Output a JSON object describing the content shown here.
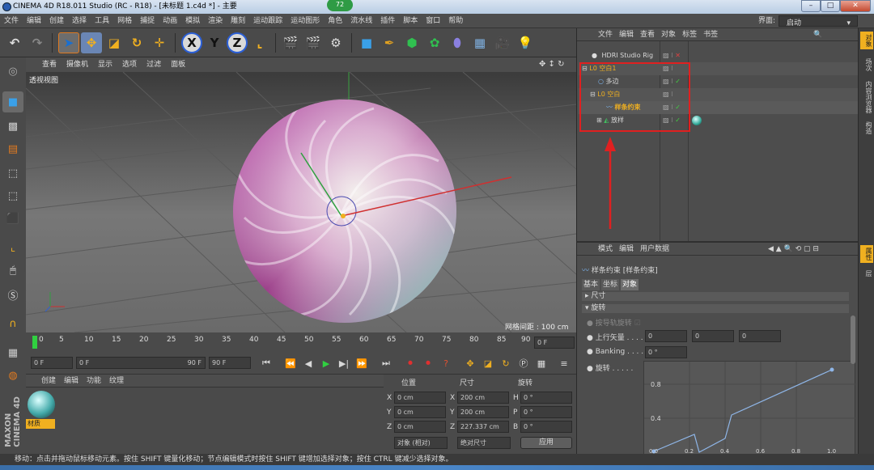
{
  "window": {
    "title": "CINEMA 4D R18.011 Studio (RC - R18) - [未标题 1.c4d *] - 主要",
    "badge": "72"
  },
  "menu": [
    "文件",
    "编辑",
    "创建",
    "选择",
    "工具",
    "网格",
    "捕捉",
    "动画",
    "模拟",
    "渲染",
    "雕刻",
    "运动跟踪",
    "运动图形",
    "角色",
    "流水线",
    "插件",
    "脚本",
    "窗口",
    "帮助"
  ],
  "layout": {
    "label": "界面:",
    "value": "启动"
  },
  "toolbar_letters": {
    "x": "X",
    "y": "Y",
    "z": "Z"
  },
  "viewport": {
    "menu": [
      "查看",
      "摄像机",
      "显示",
      "选项",
      "过滤",
      "面板"
    ],
    "label": "透视视图",
    "grid_info": "网格间距 : 100 cm"
  },
  "timeline": {
    "ticks": [
      "0",
      "5",
      "10",
      "15",
      "20",
      "25",
      "30",
      "35",
      "40",
      "45",
      "50",
      "55",
      "60",
      "65",
      "70",
      "75",
      "80",
      "85",
      "90"
    ],
    "current_frame": "0 F",
    "start_field": "0 F",
    "range_start": "0 F",
    "range_end": "90 F",
    "end_field": "90 F"
  },
  "materials": {
    "menu": [
      "创建",
      "编辑",
      "功能",
      "纹理"
    ],
    "material_name": "材质"
  },
  "coords": {
    "headers": [
      "位置",
      "尺寸",
      "旋转"
    ],
    "rows": [
      {
        "axis": "X",
        "pos": "0 cm",
        "size_axis": "X",
        "size": "200 cm",
        "rot_axis": "H",
        "rot": "0 °"
      },
      {
        "axis": "Y",
        "pos": "0 cm",
        "size_axis": "Y",
        "size": "200 cm",
        "rot_axis": "P",
        "rot": "0 °"
      },
      {
        "axis": "Z",
        "pos": "0 cm",
        "size_axis": "Z",
        "size": "227.337 cm",
        "rot_axis": "B",
        "rot": "0 °"
      }
    ],
    "mode": "对象 (相对)",
    "size_mode": "绝对尺寸",
    "apply": "应用"
  },
  "object_manager": {
    "menu": [
      "文件",
      "编辑",
      "查看",
      "对象",
      "标签",
      "书签"
    ],
    "objects": [
      {
        "name": "HDRI Studio Rig",
        "indent": 0,
        "color": "#e8e8e8"
      },
      {
        "name": "空白1",
        "indent": 0,
        "color": "#f0b020"
      },
      {
        "name": "多边",
        "indent": 1,
        "color": "#e8e8e8"
      },
      {
        "name": "空白",
        "indent": 1,
        "color": "#f0b020"
      },
      {
        "name": "样条约束",
        "indent": 2,
        "color": "#f0b020"
      },
      {
        "name": "放样",
        "indent": 2,
        "color": "#e8e8e8"
      }
    ]
  },
  "attributes": {
    "menu": [
      "模式",
      "编辑",
      "用户数据"
    ],
    "header": "样条约束 [样条约束]",
    "tabs": [
      "基本",
      "坐标",
      "对象"
    ],
    "section_size": "尺寸",
    "section_rotation": "旋转",
    "rail_rotation_label": "按导轨旋转",
    "up_vector_label": "上行矢量",
    "up_vector": [
      "0",
      "0",
      "0"
    ],
    "banking_label": "Banking",
    "banking_value": "0 °",
    "rotation_label": "旋转",
    "graph_y_labels": [
      "0.8",
      "0.4"
    ],
    "graph_x_labels": [
      "0.0",
      "0.2",
      "0.4",
      "0.6",
      "0.8",
      "1.0"
    ]
  },
  "side_tabs": [
    "对象",
    "场次",
    "内容浏览器",
    "构造",
    "属性",
    "层"
  ],
  "status": "移动：点击并拖动鼠标移动元素。按住 SHIFT 键量化移动；节点编辑模式时按住 SHIFT 键增加选择对象；按住 CTRL 键减少选择对象。",
  "colors": {
    "accent": "#f0b020",
    "highlight": "#e02020",
    "bg": "#595959"
  }
}
